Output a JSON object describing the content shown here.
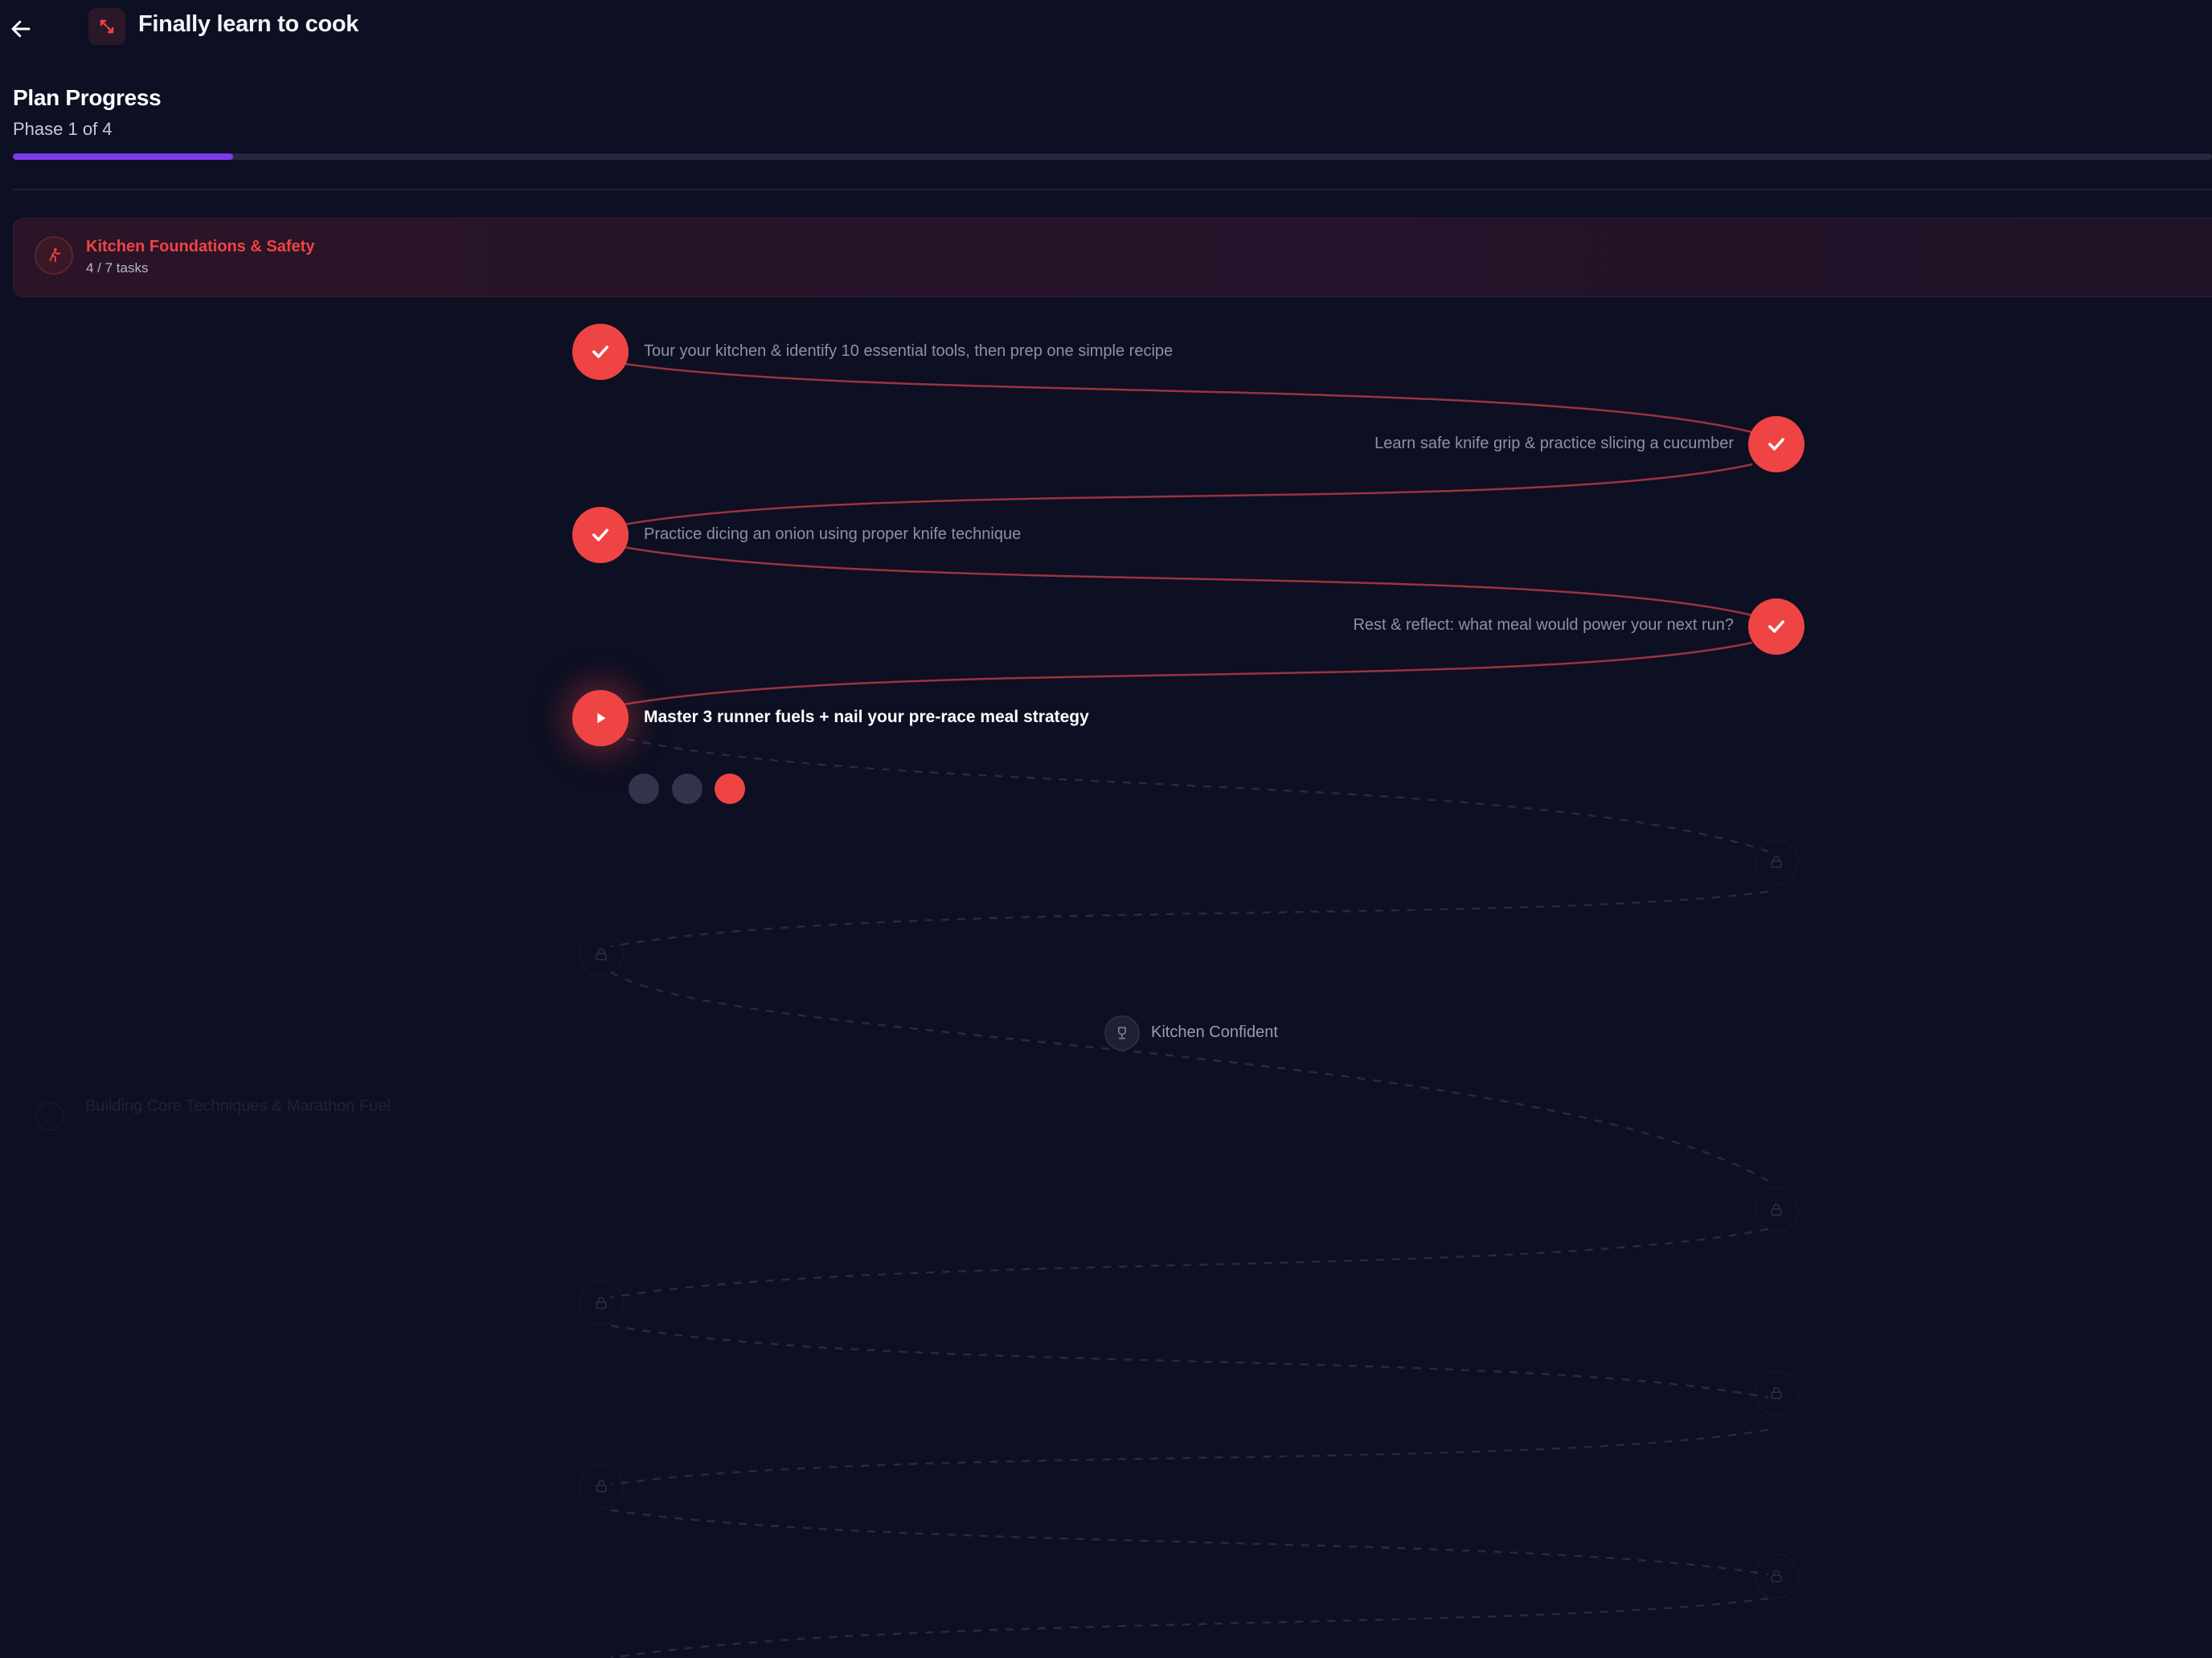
{
  "header": {
    "title": "Finally learn to cook"
  },
  "progress": {
    "title": "Plan Progress",
    "subtitle": "Phase 1 of 4",
    "fraction": 0.1
  },
  "phase": {
    "title": "Kitchen Foundations & Safety",
    "count": "4 / 7 tasks"
  },
  "tasks": [
    {
      "label": "Tour your kitchen & identify 10 essential tools, then prep one simple recipe",
      "status": "done"
    },
    {
      "label": "Learn safe knife grip & practice slicing a cucumber",
      "status": "done"
    },
    {
      "label": "Practice dicing an onion using proper knife technique",
      "status": "done"
    },
    {
      "label": "Rest & reflect: what meal would power your next run?",
      "status": "done"
    },
    {
      "label": "Master 3 runner fuels + nail your pre-race meal strategy",
      "status": "current"
    }
  ],
  "milestone": {
    "label": "Kitchen Confident",
    "icon": "trophy-icon"
  },
  "next_phase": {
    "title": "Building Core Techniques & Marathon Fuel"
  },
  "colors": {
    "accent": "#ef4444",
    "progress": "#7c3aed",
    "background": "#0d0f22"
  }
}
